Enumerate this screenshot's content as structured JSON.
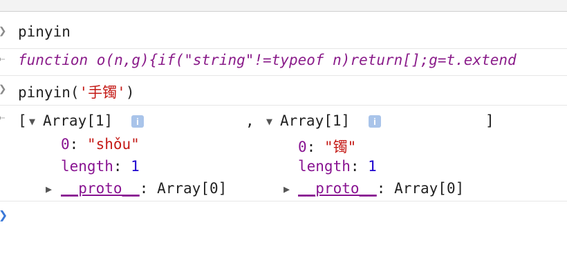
{
  "console": {
    "command1": "pinyin",
    "result1": {
      "keyword": "function",
      "code": " o(n,g){if(\"string\"!=typeof n)return[];g=t.extend"
    },
    "command2": {
      "fn": "pinyin(",
      "arg": "'手镯'",
      "close": ")"
    },
    "result2": {
      "open_bracket": "[",
      "comma": ",",
      "close_bracket": "]",
      "arrays": [
        {
          "label": "Array[1]",
          "info": "i",
          "index_key": "0",
          "value": "\"shǒu\"",
          "length_key": "length",
          "length_value": "1",
          "proto_key": "__proto__",
          "proto_value": ": Array[0]"
        },
        {
          "label": "Array[1]",
          "info": "i",
          "index_key": "0",
          "value": "\"镯\"",
          "length_key": "length",
          "length_value": "1",
          "proto_key": "__proto__",
          "proto_value": ": Array[0]"
        }
      ]
    }
  }
}
